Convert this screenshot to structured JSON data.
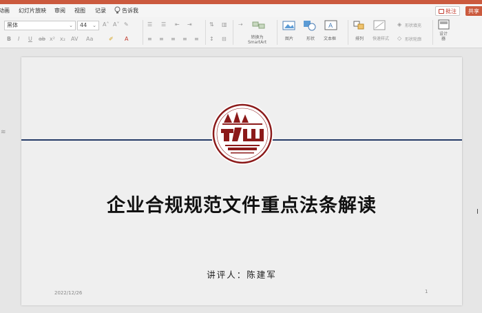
{
  "menu": {
    "items": [
      "动画",
      "幻灯片放映",
      "审阅",
      "视图",
      "记录",
      "告诉我"
    ],
    "comment_label": "批注",
    "share_label": "共享"
  },
  "ribbon": {
    "font_name": "黑体",
    "font_size": "44",
    "convert_smartart": "转换为\nSmartArt",
    "picture_label": "图片",
    "shape_label": "形状",
    "textbox_label": "文本框",
    "arrange_label": "排列",
    "quickstyle_label": "快速样式",
    "shape_fill_label": "形状填充",
    "shape_outline_label": "形状轮廓",
    "design_label": "设计\n器"
  },
  "slide": {
    "title": "企业合规规范文件重点法条解读",
    "presenter": "讲评人：陈建军",
    "date": "2022/12/26",
    "page_number": "1",
    "line_color": "#243a66",
    "logo_color": "#8b1a1a"
  },
  "colors": {
    "accent": "#cb5a3e",
    "comment_red": "#c0392b"
  }
}
